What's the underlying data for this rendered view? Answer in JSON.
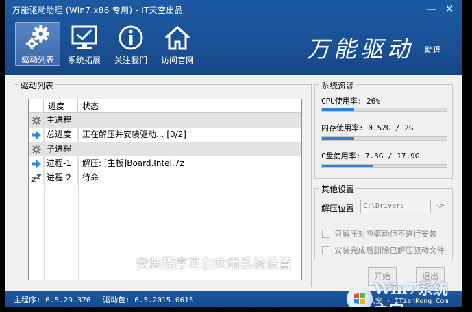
{
  "window": {
    "title": "万能驱动助理 (Win7.x86 专用) - IT天空出品",
    "min_label": "—",
    "close_label": "✕"
  },
  "toolbar": [
    {
      "label": "驱动列表",
      "icon": "gears-icon",
      "active": true
    },
    {
      "label": "系统拓展",
      "icon": "monitor-check-icon",
      "active": false
    },
    {
      "label": "关注我们",
      "icon": "info-icon",
      "active": false
    },
    {
      "label": "访问官网",
      "icon": "home-icon",
      "active": false
    }
  ],
  "brand": {
    "main": "万能驱动",
    "sub": "助理"
  },
  "driver_list": {
    "title": "驱动列表",
    "columns": [
      "进度",
      "状态"
    ],
    "rows": [
      {
        "icon": "gear-icon",
        "progress": "主进程",
        "status": "",
        "group": true
      },
      {
        "icon": "arrow-right-icon",
        "progress": "总进度",
        "status": "正在解压并安装驱动... [0/2]",
        "group": false
      },
      {
        "icon": "gear-icon",
        "progress": "子进程",
        "status": "",
        "group": true
      },
      {
        "icon": "arrow-right-icon",
        "progress": "进程-1",
        "status": "解压: [主板]Board.Intel.7z",
        "group": false
      },
      {
        "icon": "sleep-icon",
        "progress": "进程-2",
        "status": "待命",
        "group": false
      }
    ]
  },
  "resources": {
    "title": "系统资源",
    "cpu_label": "CPU使用率:  26%",
    "cpu_fraction": 0.26,
    "mem_label": "内存使用率: 0.52G / 2G",
    "mem_fraction": 0.26,
    "disk_label": "C盘使用率:  7.3G / 17.9G",
    "disk_fraction": 0.41
  },
  "settings": {
    "title": "其他设置",
    "extract_label": "解压位置",
    "extract_value": "C:\\Drivers",
    "arrow": "->",
    "opt1": "只解压对应驱动但不进行安装",
    "opt2": "安装完成后删除已解压驱动文件"
  },
  "buttons": {
    "start": "开始",
    "exit": "退出"
  },
  "overlay": "安装程序正在应用系统设置",
  "status": {
    "main": "主程序: 6.5.29.376",
    "driver": "驱动包: 6.5.2015.0615",
    "right": "IT天空 - ITianKong.Com"
  },
  "watermark": {
    "text": "Win7系统之家"
  },
  "colors": {
    "header": "#1a5197",
    "accent": "#2d83db"
  }
}
